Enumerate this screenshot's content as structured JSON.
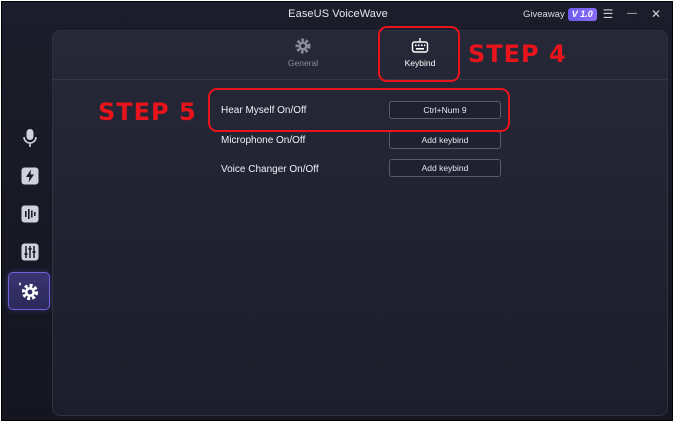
{
  "window": {
    "title": "EaseUS VoiceWave",
    "giveaway_label": "Giveaway",
    "version": "V 1.0",
    "controls": {
      "menu": "☰",
      "minimize": "—",
      "close": "✕"
    }
  },
  "sidebar": {
    "items": [
      {
        "icon": "microphone-icon"
      },
      {
        "icon": "lightning-icon"
      },
      {
        "icon": "soundboard-icon"
      },
      {
        "icon": "equalizer-icon"
      },
      {
        "icon": "settings-gear-icon",
        "active": true
      }
    ],
    "accent": "#6f62d8"
  },
  "tabs": [
    {
      "label": "General",
      "icon": "gear-icon",
      "active": false
    },
    {
      "label": "Keybind",
      "icon": "keyboard-icon",
      "active": true
    }
  ],
  "keybinds": [
    {
      "label": "Hear Myself On/Off",
      "value": "Ctrl+Num 9"
    },
    {
      "label": "Microphone On/Off",
      "value": "Add keybind"
    },
    {
      "label": "Voice Changer  On/Off",
      "value": "Add keybind"
    }
  ],
  "annotations": {
    "step4": "STEP 4",
    "step5": "STEP 5",
    "color": "#e8141c"
  }
}
